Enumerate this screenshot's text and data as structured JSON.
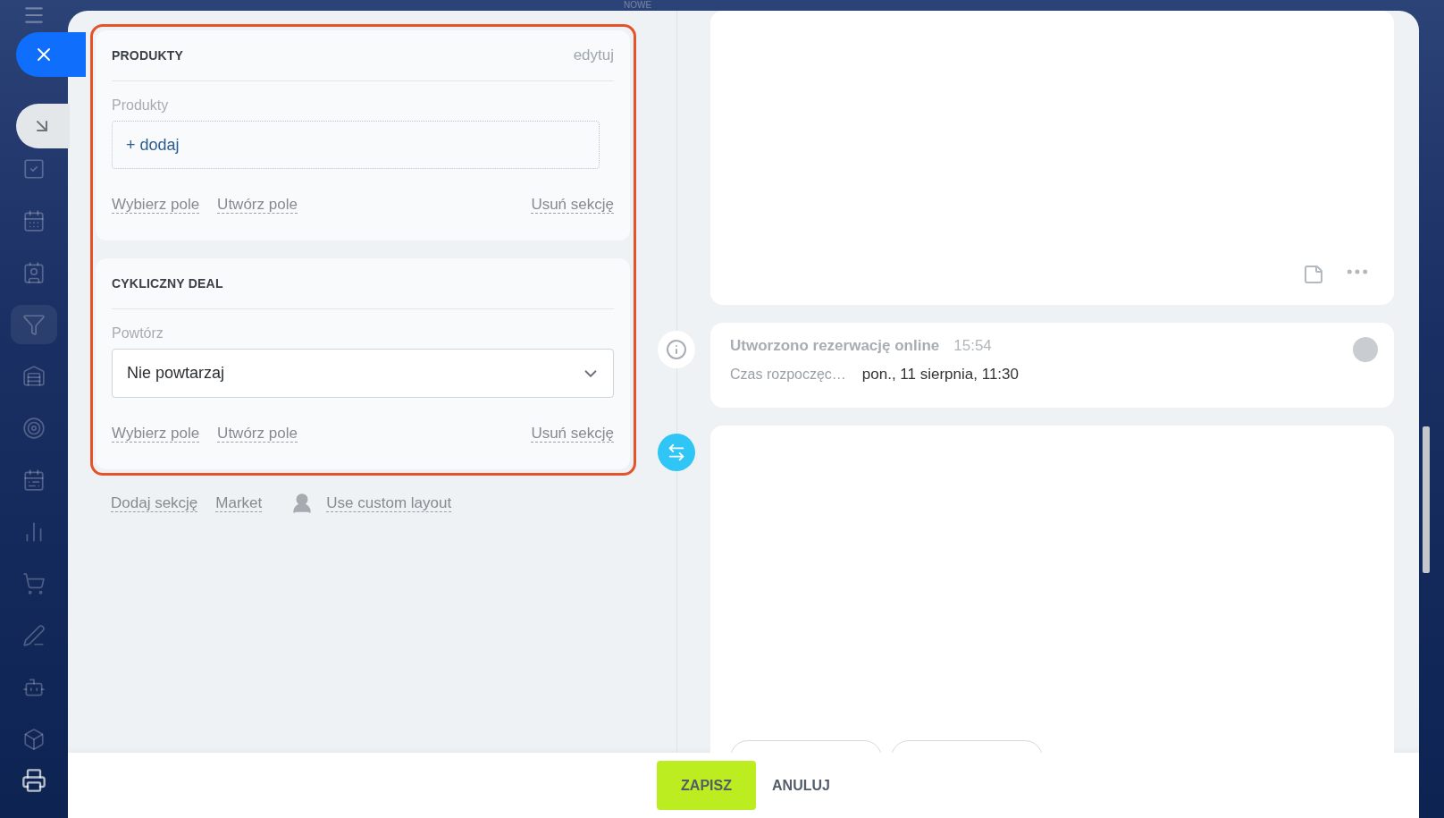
{
  "top_label": "NOWE",
  "sidebar": {
    "items": [
      {
        "selected": false
      },
      {
        "selected": false
      },
      {
        "selected": false
      },
      {
        "selected": true
      },
      {
        "selected": false
      },
      {
        "selected": false
      },
      {
        "selected": false
      },
      {
        "selected": false
      },
      {
        "selected": false
      },
      {
        "selected": false
      },
      {
        "selected": false
      },
      {
        "selected": false
      }
    ]
  },
  "sections": [
    {
      "title": "PRODUKTY",
      "edit": "edytuj",
      "field": {
        "kind": "add",
        "label": "Produkty",
        "value": "+ dodaj"
      },
      "actions": [
        "Wybierz pole",
        "Utwórz pole"
      ],
      "remove": "Usuń sekcję"
    },
    {
      "title": "CYKLICZNY DEAL",
      "field": {
        "kind": "select",
        "label": "Powtórz",
        "value": "Nie powtarzaj"
      },
      "actions": [
        "Wybierz pole",
        "Utwórz pole"
      ],
      "remove": "Usuń sekcję"
    }
  ],
  "section_links": [
    "Dodaj sekcję",
    "Market"
  ],
  "custom_layout": "Use custom layout",
  "timeline": [
    {
      "kind": "blank"
    },
    {
      "kind": "info",
      "title": "Utworzono rezerwację online",
      "time": "15:54",
      "field_label": "Czas rozpoczęc…",
      "field_value": "pon., 11 sierpnia, 11:30"
    },
    {
      "kind": "transfer"
    }
  ],
  "footer": {
    "save": "ZAPISZ",
    "cancel": "ANULUJ"
  }
}
